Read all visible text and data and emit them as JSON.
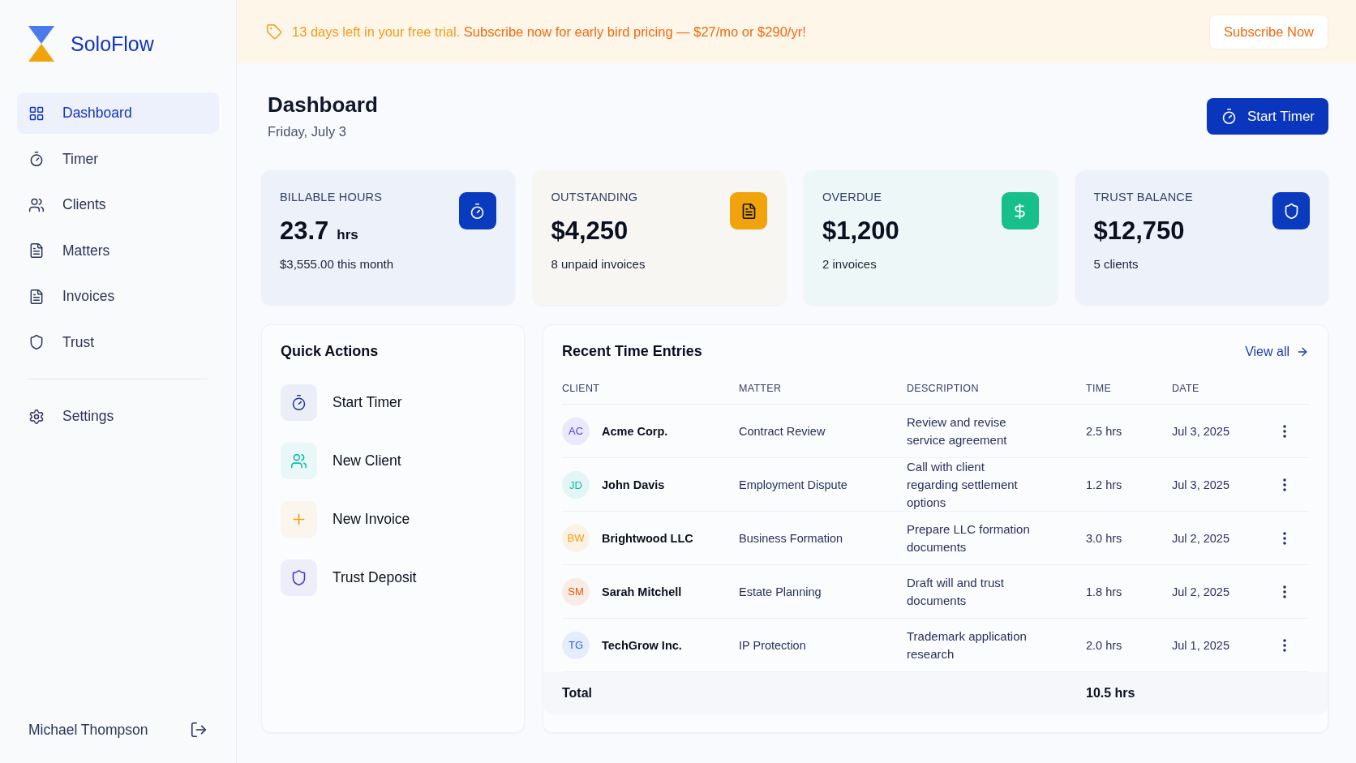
{
  "brand": {
    "name": "SoloFlow"
  },
  "sidebar": {
    "items": [
      {
        "label": "Dashboard",
        "selected": true
      },
      {
        "label": "Timer",
        "selected": false
      },
      {
        "label": "Clients",
        "selected": false
      },
      {
        "label": "Matters",
        "selected": false
      },
      {
        "label": "Invoices",
        "selected": false
      },
      {
        "label": "Trust",
        "selected": false
      }
    ],
    "footer_items": [
      {
        "label": "Settings",
        "selected": false
      }
    ],
    "user": {
      "name": "Michael Thompson"
    }
  },
  "banner": {
    "notice": "13 days left in your free trial.",
    "offer": "Subscribe now for early bird pricing — $27/mo or $290/yr!",
    "button": "Subscribe Now"
  },
  "header": {
    "title": "Dashboard",
    "date": "Friday, July 3",
    "button": "Start Timer"
  },
  "stats": [
    {
      "label": "BILLABLE HOURS",
      "value": "23.7",
      "unit": "hrs",
      "sub": "$3,555.00 this month",
      "color": "#0a3bbf"
    },
    {
      "label": "OUTSTANDING",
      "value": "$4,250",
      "sub": "8 unpaid invoices",
      "color": "#f0a30a"
    },
    {
      "label": "OVERDUE",
      "value": "$1,200",
      "sub": "2 invoices",
      "color": "#17c08a"
    },
    {
      "label": "TRUST BALANCE",
      "value": "$12,750",
      "sub": "5 clients",
      "color": "#0a3bbf"
    }
  ],
  "quick_actions": {
    "title": "Quick Actions",
    "items": [
      {
        "label": "Start Timer",
        "color": "#1e3a8a"
      },
      {
        "label": "New Client",
        "color": "#14b8a6"
      },
      {
        "label": "New Invoice",
        "color": "#f59e0b"
      },
      {
        "label": "Trust Deposit",
        "color": "#4338ca"
      }
    ]
  },
  "recent": {
    "title": "Recent Time Entries",
    "link": "View all",
    "columns": [
      "CLIENT",
      "MATTER",
      "DESCRIPTION",
      "TIME",
      "DATE"
    ],
    "rows": [
      {
        "initials": "AC",
        "color": "#4f46e5",
        "client": "Acme Corp.",
        "matter": "Contract Review",
        "description": "Review and revise service agreement",
        "time": "2.5 hrs",
        "date": "Jul 3, 2025"
      },
      {
        "initials": "JD",
        "color": "#14b8a6",
        "client": "John Davis",
        "matter": "Employment Dispute",
        "description": "Call with client regarding settlement options",
        "time": "1.2 hrs",
        "date": "Jul 3, 2025"
      },
      {
        "initials": "BW",
        "color": "#f59e0b",
        "client": "Brightwood LLC",
        "matter": "Business Formation",
        "description": "Prepare LLC formation documents",
        "time": "3.0 hrs",
        "date": "Jul 2, 2025"
      },
      {
        "initials": "SM",
        "color": "#ea580c",
        "client": "Sarah Mitchell",
        "matter": "Estate Planning",
        "description": "Draft will and trust documents",
        "time": "1.8 hrs",
        "date": "Jul 2, 2025"
      },
      {
        "initials": "TG",
        "color": "#2563eb",
        "client": "TechGrow Inc.",
        "matter": "IP Protection",
        "description": "Trademark application research",
        "time": "2.0 hrs",
        "date": "Jul 1, 2025"
      }
    ],
    "total_label": "Total",
    "total": "10.5 hrs"
  }
}
